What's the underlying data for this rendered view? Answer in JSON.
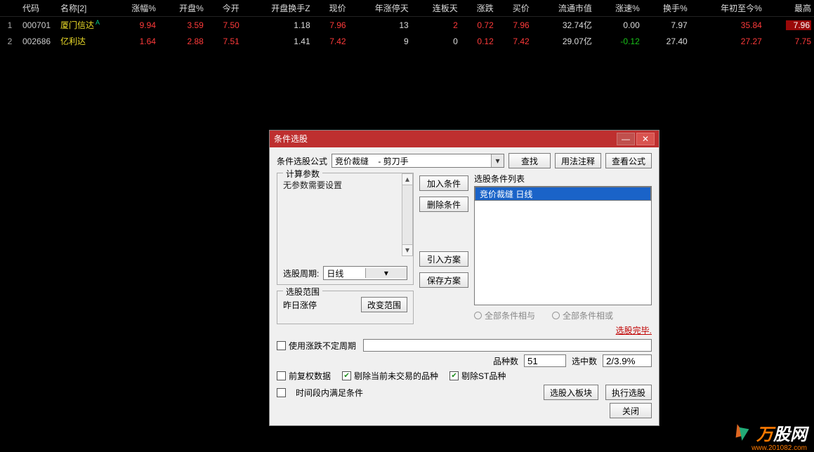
{
  "table": {
    "headers": [
      "",
      "代码",
      "名称[2]",
      "涨幅%",
      "开盘%",
      "今开",
      "开盘换手Z",
      "现价",
      "年涨停天",
      "连板天",
      "涨跌",
      "买价",
      "流通市值",
      "涨速%",
      "换手%",
      "年初至今%",
      "最高"
    ],
    "rows": [
      {
        "n": "1",
        "code": "000701",
        "name": "厦门信达",
        "sup": "A",
        "chg": "9.94",
        "openpct": "3.59",
        "open": "7.50",
        "turnz": "1.18",
        "price": "7.96",
        "yupdays": "13",
        "limdays": "2",
        "delta": "0.72",
        "bid": "7.96",
        "mcap": "32.74亿",
        "spd": "0.00",
        "turn": "7.97",
        "ytd": "35.84",
        "high": "7.96",
        "highhl": true,
        "limcls": "red",
        "spdcls": "wht"
      },
      {
        "n": "2",
        "code": "002686",
        "name": "亿利达",
        "sup": "",
        "chg": "1.64",
        "openpct": "2.88",
        "open": "7.51",
        "turnz": "1.41",
        "price": "7.42",
        "yupdays": "9",
        "limdays": "0",
        "delta": "0.12",
        "bid": "7.42",
        "mcap": "29.07亿",
        "spd": "-0.12",
        "turn": "27.40",
        "ytd": "27.27",
        "high": "7.75",
        "highhl": false,
        "limcls": "wht",
        "spdcls": "grn"
      }
    ]
  },
  "dialog": {
    "title": "条件选股",
    "formulaLabel": "条件选股公式",
    "formulaValue": "竞价裁缝    - 剪刀手",
    "btnFind": "查找",
    "btnUsage": "用法注释",
    "btnView": "查看公式",
    "grpParams": "计算参数",
    "paramsText": "无参数需要设置",
    "periodLabel": "选股周期:",
    "periodValue": "日线",
    "grpRange": "选股范围",
    "rangeText": "昨日涨停",
    "btnChangeRange": "改变范围",
    "btnAdd": "加入条件",
    "btnDel": "删除条件",
    "btnImport": "引入方案",
    "btnSave": "保存方案",
    "listLabel": "选股条件列表",
    "listItem": "竞价裁缝  日线",
    "radioAnd": "全部条件相与",
    "radioOr": "全部条件相或",
    "linkDone": "选股完毕.",
    "chkVarPeriod": "使用涨跌不定周期",
    "statVarietyLbl": "品种数",
    "statVarietyVal": "51",
    "statSelLbl": "选中数",
    "statSelVal": "2/3.9%",
    "chkFq": "前复权数据",
    "chkExclNoTrade": "剔除当前未交易的品种",
    "chkExclST": "剔除ST品种",
    "chkInPeriod": "时间段内满足条件",
    "btnToBlock": "选股入板块",
    "btnRun": "执行选股",
    "btnClose": "关闭"
  },
  "watermark": {
    "t1": "万",
    "t2": "股网",
    "sub": "www.201082.com"
  }
}
